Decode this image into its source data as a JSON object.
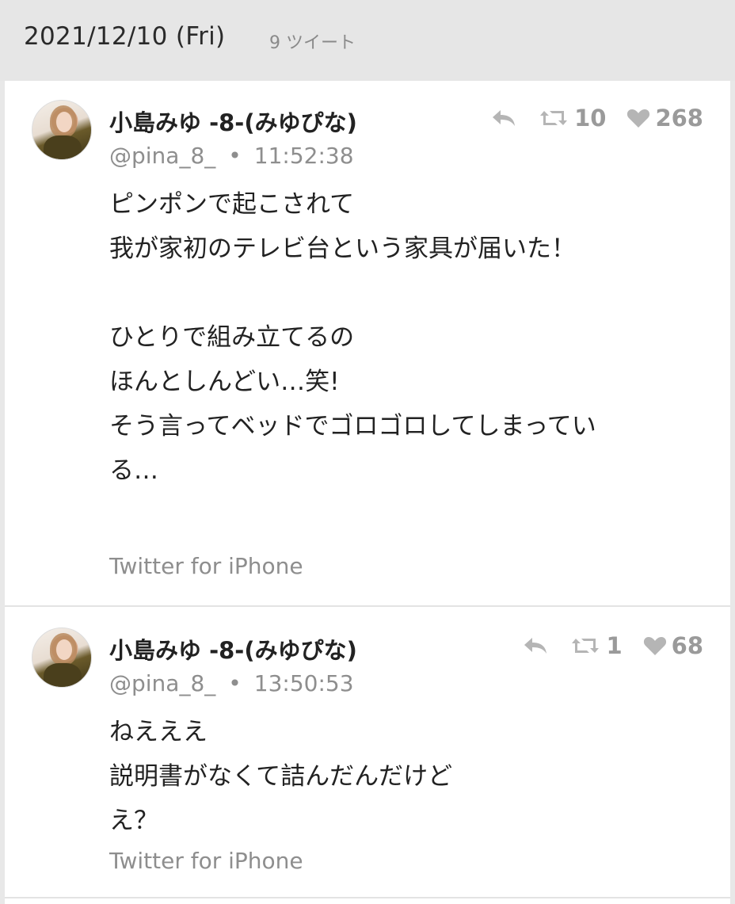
{
  "header": {
    "date": "2021/12/10 (Fri)",
    "count": "9 ツイート"
  },
  "tweets": [
    {
      "name": "小島みゆ -8-(みゆぴな)",
      "handle": "@pina_8_",
      "separator": "•",
      "time": "11:52:38",
      "retweets": "10",
      "likes": "268",
      "lines": [
        "ピンポンで起こされて",
        "我が家初のテレビ台という家具が届いた！",
        "",
        "ひとりで組み立てるの",
        "ほんとしんどい…笑!",
        "そう言ってベッドでゴロゴロしてしまってい",
        "る…"
      ],
      "source": "Twitter for iPhone"
    },
    {
      "name": "小島みゆ -8-(みゆぴな)",
      "handle": "@pina_8_",
      "separator": "•",
      "time": "13:50:53",
      "retweets": "1",
      "likes": "68",
      "lines": [
        "ねえええ",
        "説明書がなくて詰んだんだけど",
        "え？"
      ],
      "source": "Twitter for iPhone"
    }
  ],
  "icons": {
    "reply": "reply-icon",
    "retweet": "retweet-icon",
    "like": "heart-icon"
  },
  "colors": {
    "muted": "#8e8e8e",
    "icon": "#9a9a9a"
  }
}
